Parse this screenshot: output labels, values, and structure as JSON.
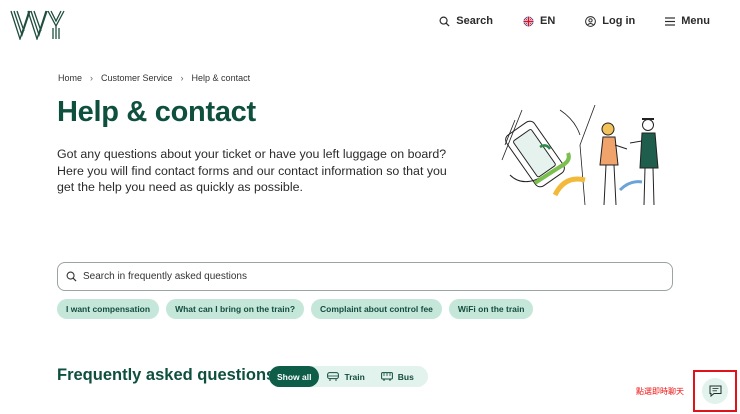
{
  "header": {
    "logo_name": "vy-logo",
    "nav": [
      {
        "label": "Search",
        "icon": "search-icon"
      },
      {
        "label": "EN",
        "icon": "uk-flag-icon"
      },
      {
        "label": "Log in",
        "icon": "user-icon"
      },
      {
        "label": "Menu",
        "icon": "menu-icon"
      }
    ]
  },
  "breadcrumb": [
    "Home",
    "Customer Service",
    "Help & contact"
  ],
  "page": {
    "title": "Help & contact",
    "intro": "Got any questions about your ticket or have you left luggage on board? Here you will find contact forms and our contact information so that you get the help you need as quickly as possible."
  },
  "search": {
    "placeholder": "Search in frequently asked questions",
    "value": ""
  },
  "quick_links": [
    "I want compensation",
    "What can I bring on the train?",
    "Complaint about control fee",
    "WiFi on the train"
  ],
  "faq": {
    "title": "Frequently asked questions",
    "filters": [
      {
        "label": "Show all",
        "active": true
      },
      {
        "label": "Train",
        "icon": "train-icon",
        "active": false
      },
      {
        "label": "Bus",
        "icon": "bus-icon",
        "active": false
      }
    ]
  },
  "chat": {
    "label": "點選即時聊天",
    "icon": "chat-icon"
  },
  "colors": {
    "brand_green": "#0e4f3e",
    "chip_bg": "#c5e7da",
    "active_filter": "#0e5d48",
    "highlight_red": "#e0131b"
  }
}
